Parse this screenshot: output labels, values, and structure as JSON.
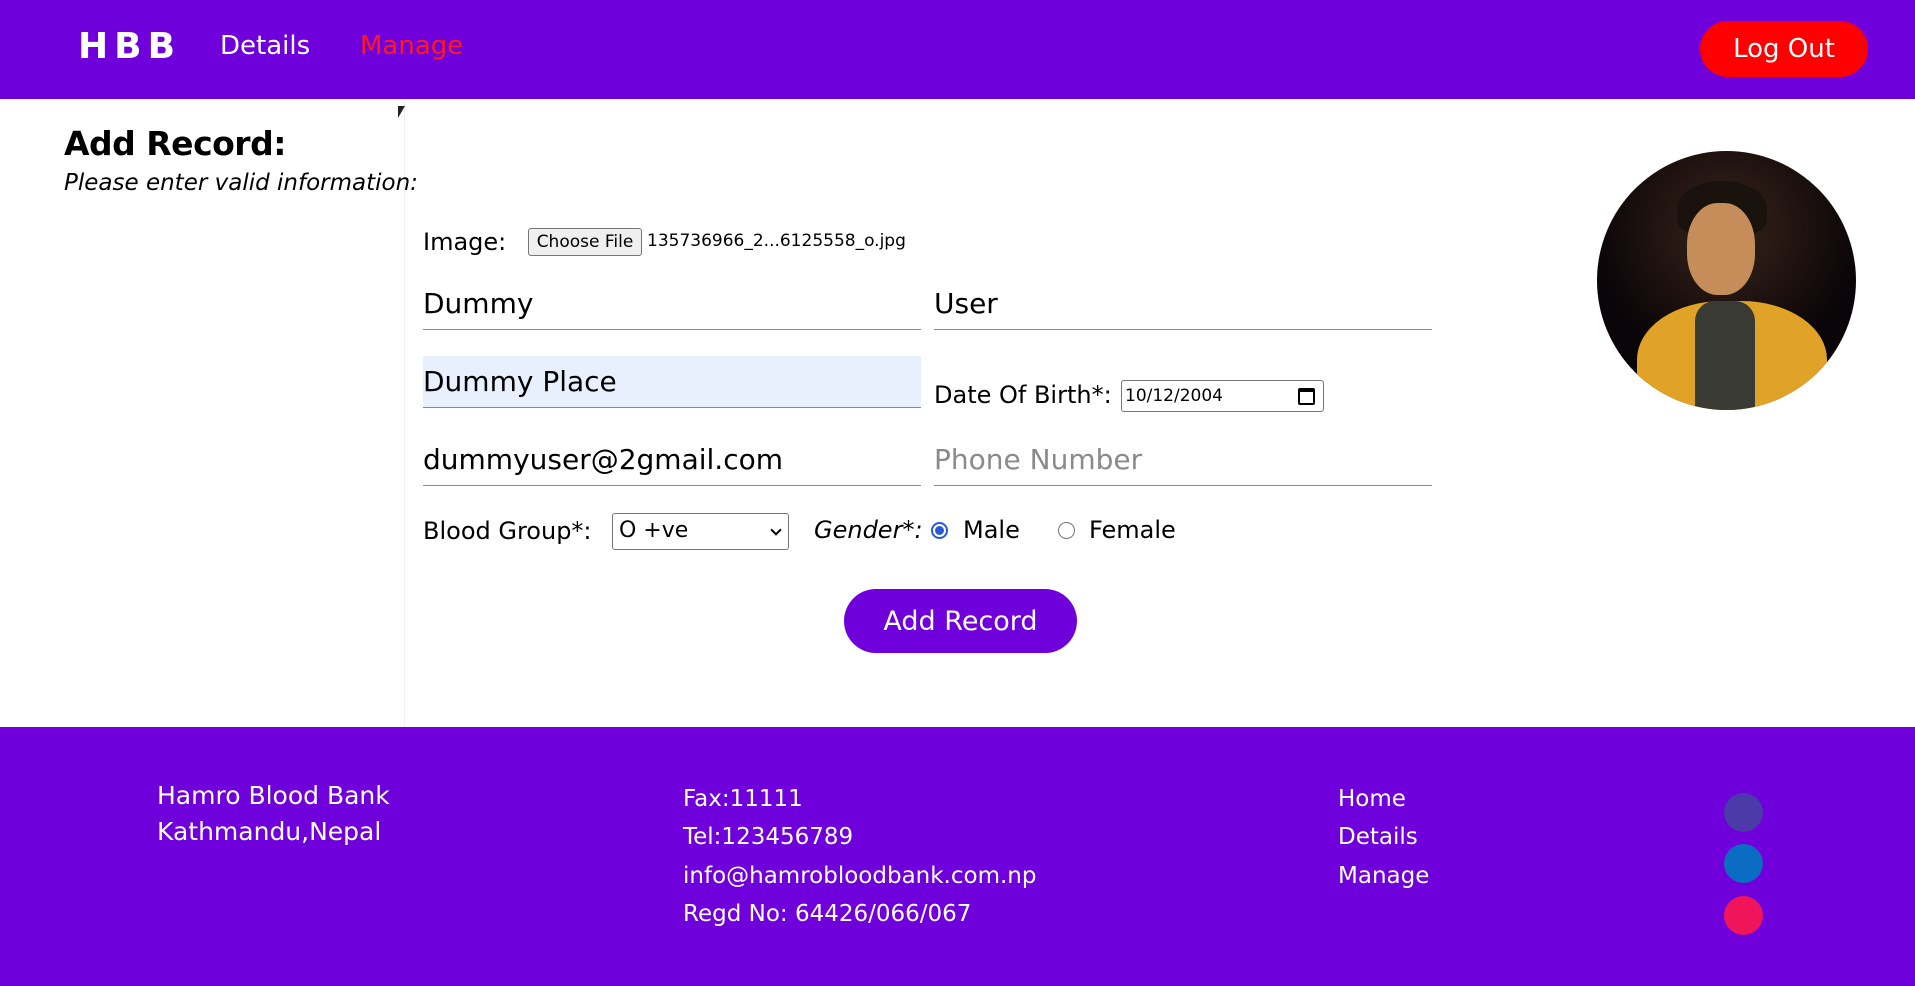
{
  "navbar": {
    "brand": "HBB",
    "links": [
      "Details",
      "Manage"
    ],
    "logout_label": "Log Out",
    "active_link_color": "#ff1a1a",
    "bg_color": "#6f00dc"
  },
  "main": {
    "title": "Add Record:",
    "subtitle": "Please enter valid information:",
    "image_label": "Image:",
    "choose_file_label": "Choose File",
    "file_name": "135736966_2...6125558_o.jpg",
    "first_name": "Dummy",
    "last_name": "User",
    "address": "Dummy Place",
    "dob_label": "Date Of Birth*:",
    "dob_value": "10/12/2004",
    "email": "dummyuser@2gmail.com",
    "phone_placeholder": "Phone Number",
    "blood_group_label": "Blood Group*:",
    "blood_group_value": "O +ve",
    "gender_label": "Gender*:",
    "gender_options": [
      "Male",
      "Female"
    ],
    "gender_selected": "Male",
    "submit_label": "Add Record"
  },
  "footer": {
    "org_name": "Hamro Blood Bank",
    "org_location": "Kathmandu,Nepal",
    "fax": "Fax:11111",
    "tel": "Tel:123456789",
    "email": "info@hamrobloodbank.com.np",
    "regd": "Regd No: 64426/066/067",
    "links": [
      "Home",
      "Details",
      "Manage"
    ],
    "social_colors": [
      "#4b3aa8",
      "#0b6cc4",
      "#f0145a"
    ],
    "social_icons": [
      "facebook-icon",
      "linkedin-icon",
      "instagram-icon"
    ]
  }
}
